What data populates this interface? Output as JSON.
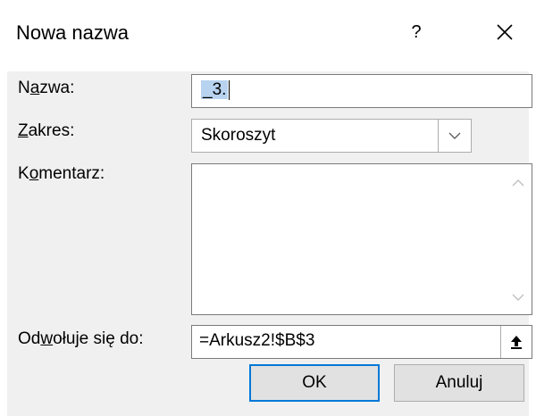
{
  "dialog": {
    "title": "Nowa nazwa",
    "help_label": "?",
    "close_label": "✕"
  },
  "fields": {
    "name": {
      "label_pre": "N",
      "label_mnemonic": "a",
      "label_post": "zwa:",
      "value": "_3."
    },
    "scope": {
      "label_mnemonic": "Z",
      "label_post": "akres:",
      "value": "Skoroszyt"
    },
    "comment": {
      "label_pre": "K",
      "label_mnemonic": "o",
      "label_post": "mentarz:",
      "value": ""
    },
    "refers_to": {
      "label_pre": "Od",
      "label_mnemonic": "w",
      "label_post": "ołuje się do:",
      "value": "=Arkusz2!$B$3"
    }
  },
  "buttons": {
    "ok": "OK",
    "cancel": "Anuluj"
  }
}
